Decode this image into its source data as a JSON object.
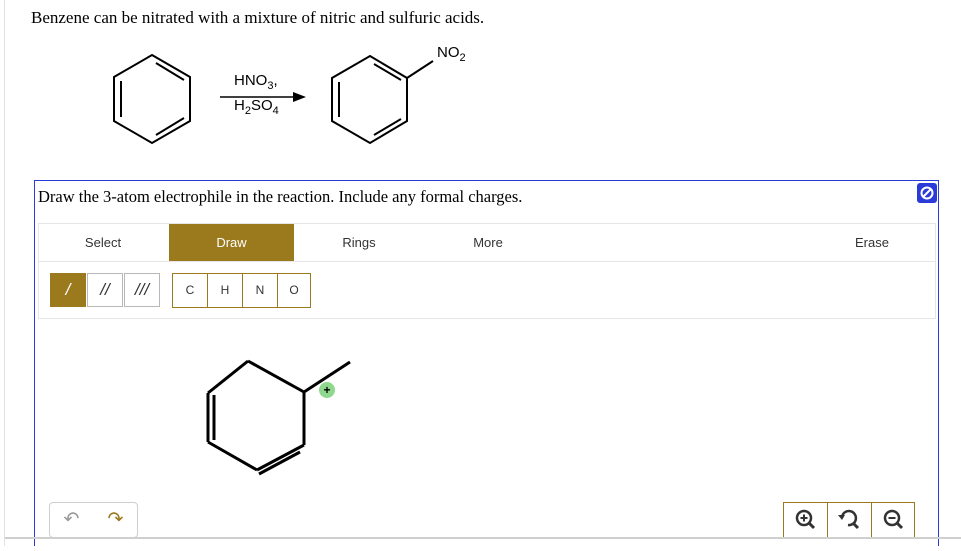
{
  "intro_text": "Benzene can be nitrated with a mixture of nitric and sulfuric acids.",
  "scheme": {
    "reagent_top_main": "HNO",
    "reagent_top_sub": "3",
    "reagent_top_tail": ",",
    "reagent_bottom_pre": "H",
    "reagent_bottom_sub1": "2",
    "reagent_bottom_mid": "SO",
    "reagent_bottom_sub2": "4",
    "product_group_main": "NO",
    "product_group_sub": "2"
  },
  "question": {
    "prompt": "Draw the 3-atom electrophile in the reaction. Include any formal charges."
  },
  "toolbar": {
    "tabs": [
      {
        "label": "Select",
        "active": false
      },
      {
        "label": "Draw",
        "active": true
      },
      {
        "label": "Rings",
        "active": false
      },
      {
        "label": "More",
        "active": false
      },
      {
        "label": "Erase",
        "active": false
      }
    ],
    "bonds": [
      {
        "name": "single-bond",
        "label": "/",
        "active": true
      },
      {
        "name": "double-bond",
        "label": "//",
        "active": false
      },
      {
        "name": "triple-bond",
        "label": "///",
        "active": false
      }
    ],
    "atoms": [
      "C",
      "H",
      "N",
      "O"
    ]
  },
  "canvas": {
    "charge_badge": "+"
  },
  "icons": {
    "help": "no-entry-icon",
    "undo": "undo-icon",
    "redo": "redo-icon",
    "zoom_in": "zoom-in-icon",
    "zoom_reset": "zoom-reset-icon",
    "zoom_out": "zoom-out-icon"
  },
  "colors": {
    "accent": "#9a7a1c",
    "panel_border": "#2a3bd8",
    "charge_badge": "#8fd98f"
  }
}
